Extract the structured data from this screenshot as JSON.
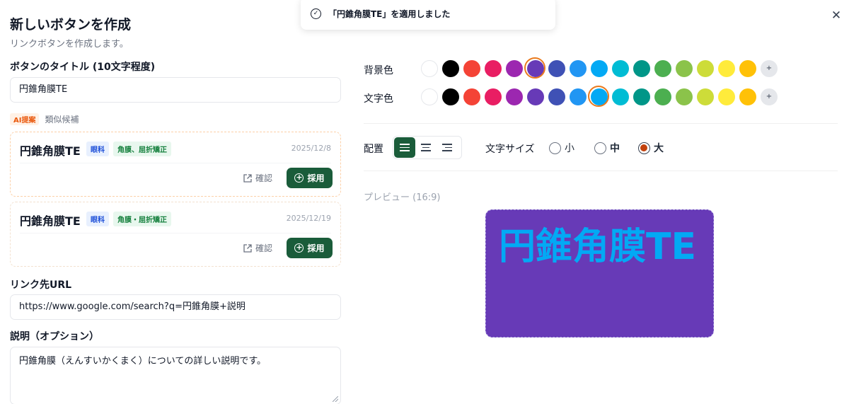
{
  "header": {
    "title": "新しいボタンを作成",
    "subtitle": "リンクボタンを作成します。",
    "close": "✕"
  },
  "toast": {
    "message": "「円錐角膜TE」を適用しました"
  },
  "form": {
    "title_label": "ボタンのタイトル (10文字程度)",
    "title_value": "円錐角膜TE",
    "ai_badge": "AI提案",
    "ai_similar": "類似候補",
    "url_label": "リンク先URL",
    "url_value": "https://www.google.com/search?q=円錐角膜+説明",
    "desc_label": "説明（オプション）",
    "desc_value": "円錐角膜（えんすいかくまく）についての詳しい説明です。"
  },
  "candidates": [
    {
      "title": "円錐角膜TE",
      "tag1": "眼科",
      "tag2": "角膜、屈折矯正",
      "date": "2025/12/8",
      "confirm": "確認",
      "adopt": "採用"
    },
    {
      "title": "円錐角膜TE",
      "tag1": "眼科",
      "tag2": "角膜・屈折矯正",
      "date": "2025/12/19",
      "confirm": "確認",
      "adopt": "採用"
    }
  ],
  "colors": {
    "bg_label": "背景色",
    "text_label": "文字色",
    "palette": [
      "#ffffff",
      "#000000",
      "#f44336",
      "#e91e63",
      "#9c27b0",
      "#673ab7",
      "#3f51b5",
      "#2196f3",
      "#03a9f4",
      "#00bcd4",
      "#009688",
      "#4caf50",
      "#8bc34a",
      "#cddc39",
      "#ffeb3b",
      "#ffc107"
    ],
    "bg_selected": "#673ab7",
    "text_selected": "#03a9f4",
    "more": "+"
  },
  "layout_opts": {
    "align_label": "配置",
    "align_selected": "left",
    "fontsize_label": "文字サイズ",
    "sizes": [
      "小",
      "中",
      "大"
    ],
    "size_selected": "大"
  },
  "preview": {
    "label": "プレビュー (16:9)",
    "text": "円錐角膜TE"
  }
}
